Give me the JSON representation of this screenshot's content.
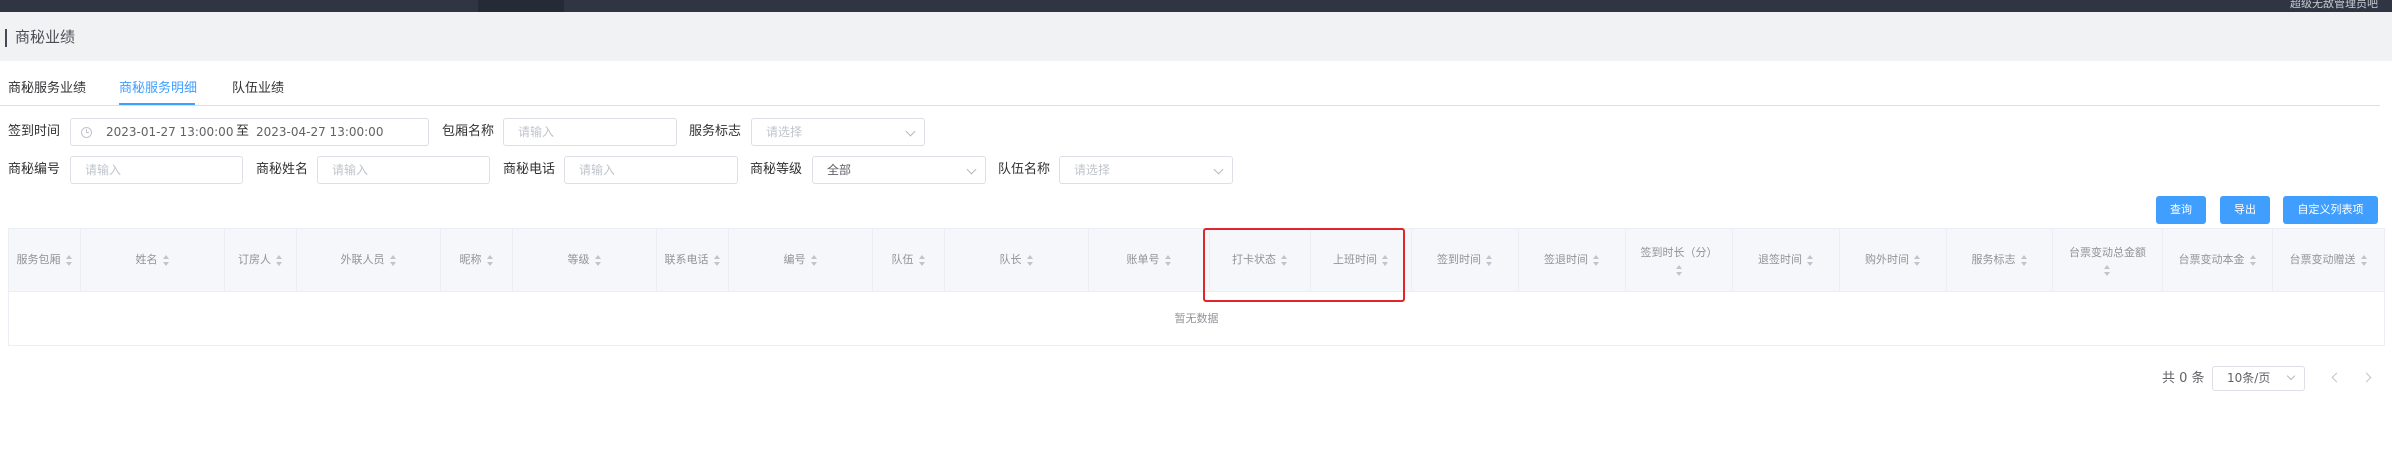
{
  "topbar": {
    "right_text": "超级无敌管理员吧"
  },
  "page": {
    "title": "商秘业绩"
  },
  "tabs": [
    {
      "label": "商秘服务业绩"
    },
    {
      "label": "商秘服务明细",
      "active": true
    },
    {
      "label": "队伍业绩"
    }
  ],
  "filters": {
    "sign_in_time_label": "签到时间",
    "date_start": "2023-01-27 13:00:00",
    "date_to": "至",
    "date_end": "2023-04-27 13:00:00",
    "room_name_label": "包厢名称",
    "room_name_placeholder": "请输入",
    "service_flag_label": "服务标志",
    "service_flag_placeholder": "请选择",
    "sec_no_label": "商秘编号",
    "sec_no_placeholder": "请输入",
    "sec_name_label": "商秘姓名",
    "sec_name_placeholder": "请输入",
    "sec_phone_label": "商秘电话",
    "sec_phone_placeholder": "请输入",
    "sec_level_label": "商秘等级",
    "sec_level_value": "全部",
    "team_name_label": "队伍名称",
    "team_name_placeholder": "请选择"
  },
  "actions": {
    "query": "查询",
    "export": "导出",
    "custom_columns": "自定义列表项"
  },
  "table": {
    "columns": [
      "服务包厢",
      "姓名",
      "订房人",
      "外联人员",
      "昵称",
      "等级",
      "联系电话",
      "编号",
      "队伍",
      "队长",
      "账单号",
      "打卡状态",
      "上班时间",
      "签到时间",
      "签退时间",
      "签到时长（分）",
      "退签时间",
      "购外时间",
      "服务标志",
      "台票变动总金额",
      "台票变动本金",
      "台票变动赠送"
    ],
    "empty_text": "暂无数据"
  },
  "pagination": {
    "total": "共 0 条",
    "page_size": "10条/页"
  },
  "colors": {
    "accent": "#409eff",
    "highlight": "#e0262b"
  }
}
